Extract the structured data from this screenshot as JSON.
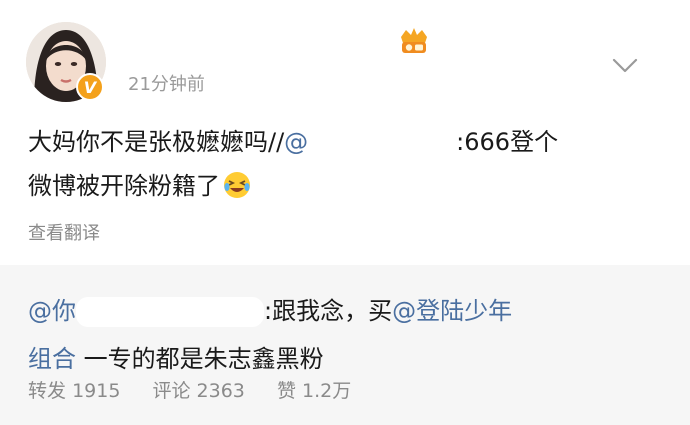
{
  "header": {
    "time": "21分钟前",
    "verified_badge": "V",
    "icons": [
      "avatar",
      "verified-icon",
      "crown-badge-icon",
      "chevron-down-icon"
    ],
    "verified_color": "#f4a11b",
    "badge_color": "#f5a623"
  },
  "post": {
    "line1_text": "大妈你不是张极嬷嬷吗//",
    "line1_suffix": ":666登个",
    "line2_text": "微博被开除粉籍了",
    "emoji": "laughing-tears-emoji",
    "translate_label": "查看翻译"
  },
  "repost": {
    "mention_start": "@你",
    "text_after": ":跟我念，买",
    "mention_group_line1": "@登陆少年",
    "mention_group_line2": "组合",
    "text_end": " 一专的都是朱志鑫黑粉",
    "link_color": "#4a6fa0",
    "background": "#f6f6f6"
  },
  "stats": {
    "repost_label": "转发",
    "repost_count": "1915",
    "comment_label": "评论",
    "comment_count": "2363",
    "like_label": "赞",
    "like_count": "1.2万"
  }
}
